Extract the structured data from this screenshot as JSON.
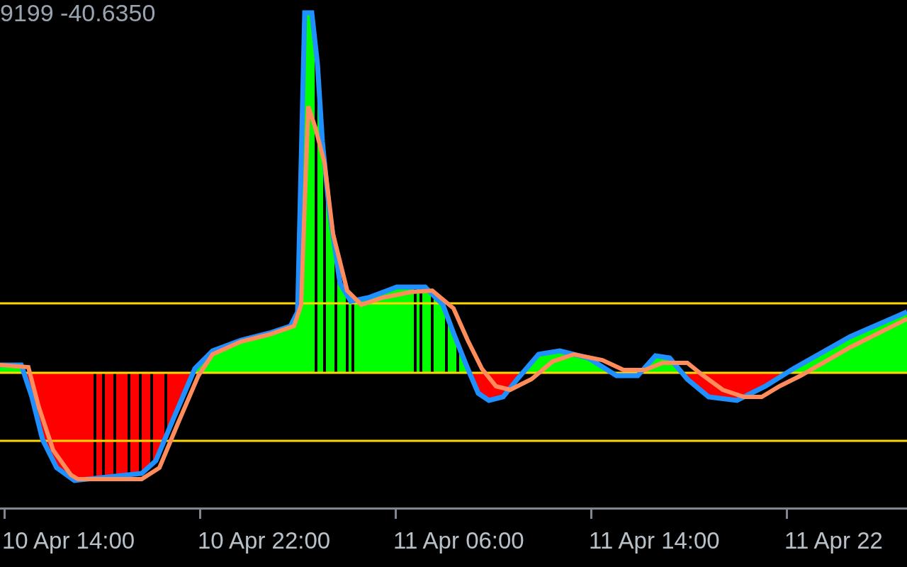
{
  "indicator_values": "9199 -40.6350",
  "time_axis": {
    "labels": [
      "10 Apr 14:00",
      "10 Apr 22:00",
      "11 Apr 06:00",
      "11 Apr 14:00",
      "11 Apr 22"
    ]
  }
}
